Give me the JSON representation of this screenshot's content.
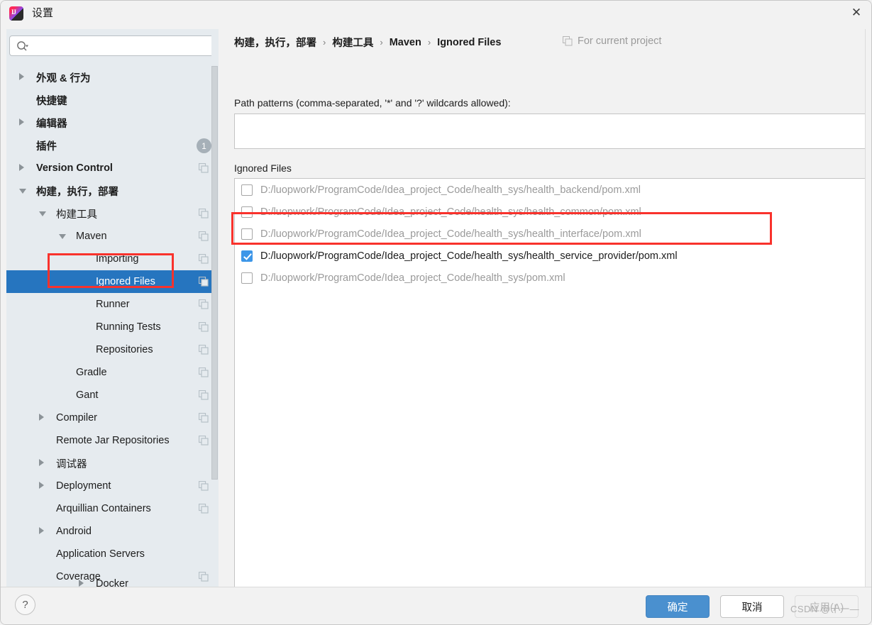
{
  "window": {
    "title": "设置",
    "app_icon": "intellij-idea-icon",
    "close_icon": "close-icon"
  },
  "sidebar": {
    "search": {
      "placeholder": "",
      "value": "",
      "icon": "search-icon"
    },
    "items": [
      {
        "label": "外观 & 行为",
        "indent": 0,
        "arrow": "right",
        "bold": true,
        "copy": false,
        "badge": null,
        "selected": false
      },
      {
        "label": "快捷键",
        "indent": 0,
        "arrow": "none",
        "bold": true,
        "copy": false,
        "badge": null,
        "selected": false
      },
      {
        "label": "编辑器",
        "indent": 0,
        "arrow": "right",
        "bold": true,
        "copy": false,
        "badge": null,
        "selected": false
      },
      {
        "label": "插件",
        "indent": 0,
        "arrow": "none",
        "bold": true,
        "copy": false,
        "badge": "1",
        "selected": false
      },
      {
        "label": "Version Control",
        "indent": 0,
        "arrow": "right",
        "bold": true,
        "copy": true,
        "badge": null,
        "selected": false
      },
      {
        "label": "构建，执行，部署",
        "indent": 0,
        "arrow": "down",
        "bold": true,
        "copy": false,
        "badge": null,
        "selected": false
      },
      {
        "label": "构建工具",
        "indent": 1,
        "arrow": "down",
        "bold": false,
        "copy": true,
        "badge": null,
        "selected": false
      },
      {
        "label": "Maven",
        "indent": 2,
        "arrow": "down",
        "bold": false,
        "copy": true,
        "badge": null,
        "selected": false
      },
      {
        "label": "Importing",
        "indent": 3,
        "arrow": "none",
        "bold": false,
        "copy": true,
        "badge": null,
        "selected": false
      },
      {
        "label": "Ignored Files",
        "indent": 3,
        "arrow": "none",
        "bold": false,
        "copy": true,
        "badge": null,
        "selected": true
      },
      {
        "label": "Runner",
        "indent": 3,
        "arrow": "none",
        "bold": false,
        "copy": true,
        "badge": null,
        "selected": false
      },
      {
        "label": "Running Tests",
        "indent": 3,
        "arrow": "none",
        "bold": false,
        "copy": true,
        "badge": null,
        "selected": false
      },
      {
        "label": "Repositories",
        "indent": 3,
        "arrow": "none",
        "bold": false,
        "copy": true,
        "badge": null,
        "selected": false
      },
      {
        "label": "Gradle",
        "indent": 2,
        "arrow": "none",
        "bold": false,
        "copy": true,
        "badge": null,
        "selected": false
      },
      {
        "label": "Gant",
        "indent": 2,
        "arrow": "none",
        "bold": false,
        "copy": true,
        "badge": null,
        "selected": false
      },
      {
        "label": "Compiler",
        "indent": 1,
        "arrow": "right",
        "bold": false,
        "copy": true,
        "badge": null,
        "selected": false
      },
      {
        "label": "Remote Jar Repositories",
        "indent": 1,
        "arrow": "none",
        "bold": false,
        "copy": true,
        "badge": null,
        "selected": false
      },
      {
        "label": "调试器",
        "indent": 1,
        "arrow": "right",
        "bold": false,
        "copy": false,
        "badge": null,
        "selected": false
      },
      {
        "label": "Deployment",
        "indent": 1,
        "arrow": "right",
        "bold": false,
        "copy": true,
        "badge": null,
        "selected": false
      },
      {
        "label": "Arquillian Containers",
        "indent": 1,
        "arrow": "none",
        "bold": false,
        "copy": true,
        "badge": null,
        "selected": false
      },
      {
        "label": "Android",
        "indent": 1,
        "arrow": "right",
        "bold": false,
        "copy": false,
        "badge": null,
        "selected": false
      },
      {
        "label": "Application Servers",
        "indent": 1,
        "arrow": "none",
        "bold": false,
        "copy": false,
        "badge": null,
        "selected": false
      },
      {
        "label": "Coverage",
        "indent": 1,
        "arrow": "none",
        "bold": false,
        "copy": true,
        "badge": null,
        "selected": false
      },
      {
        "label": "Docker",
        "indent": 1,
        "arrow": "right",
        "bold": false,
        "copy": false,
        "badge": null,
        "selected": false
      }
    ]
  },
  "content": {
    "breadcrumb": [
      "构建，执行，部署",
      "构建工具",
      "Maven",
      "Ignored Files"
    ],
    "breadcrumb_separator": "›",
    "for_current_project": "For current project",
    "for_current_project_icon": "copy-icon",
    "path_patterns_label": "Path patterns (comma-separated, '*' and '?' wildcards allowed):",
    "path_patterns_value": "",
    "path_patterns_placeholder": "",
    "ignored_files_label": "Ignored Files",
    "files": [
      {
        "path": "D:/luopwork/ProgramCode/Idea_project_Code/health_sys/health_backend/pom.xml",
        "checked": false
      },
      {
        "path": "D:/luopwork/ProgramCode/Idea_project_Code/health_sys/health_common/pom.xml",
        "checked": false
      },
      {
        "path": "D:/luopwork/ProgramCode/Idea_project_Code/health_sys/health_interface/pom.xml",
        "checked": false
      },
      {
        "path": "D:/luopwork/ProgramCode/Idea_project_Code/health_sys/health_service_provider/pom.xml",
        "checked": true
      },
      {
        "path": "D:/luopwork/ProgramCode/Idea_project_Code/health_sys/pom.xml",
        "checked": false
      }
    ]
  },
  "footer": {
    "help_label": "?",
    "ok_label": "确定",
    "cancel_label": "取消",
    "apply_label": "应用(A)",
    "watermark": "CSDN @十一—"
  },
  "colors": {
    "selection_blue": "#2675bf",
    "checkbox_blue": "#3d96e8",
    "annotation_red": "#f9322c",
    "ok_button_blue": "#4a90cf",
    "sidebar_bg": "#e6ebef"
  }
}
